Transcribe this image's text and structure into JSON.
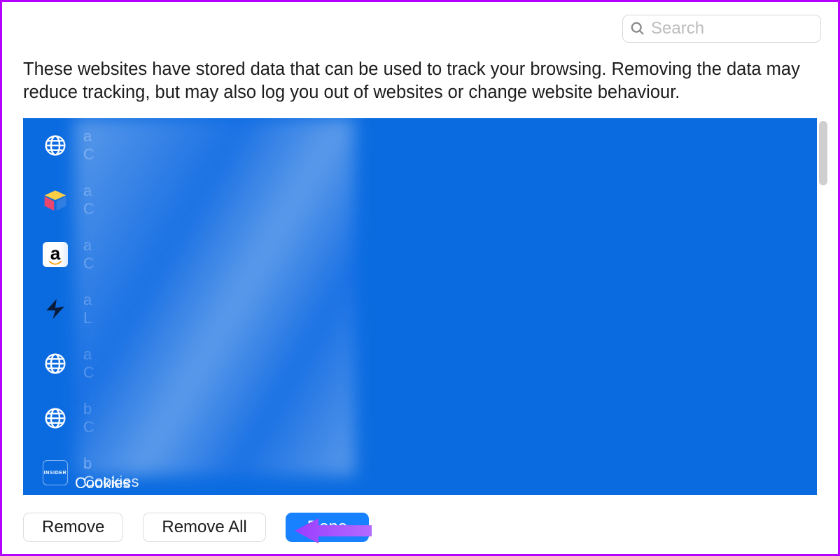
{
  "search": {
    "placeholder": "Search"
  },
  "description": "These websites have stored data that can be used to track your browsing. Removing the data may reduce tracking, but may also log you out of websites or change website behaviour.",
  "rows": [
    {
      "icon": "globe",
      "title": "a",
      "sub": "C"
    },
    {
      "icon": "airtable",
      "title": "a",
      "sub": "C"
    },
    {
      "icon": "amazon",
      "title": "a",
      "sub": "C"
    },
    {
      "icon": "star",
      "title": "a",
      "sub": "L"
    },
    {
      "icon": "globe",
      "title": "a",
      "sub": "C"
    },
    {
      "icon": "globe",
      "title": "b",
      "sub": "C"
    },
    {
      "icon": "insider",
      "title": "b",
      "sub": "Cookies"
    }
  ],
  "cookies_peek": "Cookies",
  "buttons": {
    "remove": "Remove",
    "remove_all": "Remove All",
    "done": "Done"
  },
  "icons": {
    "insider_text": "INSIDER"
  }
}
